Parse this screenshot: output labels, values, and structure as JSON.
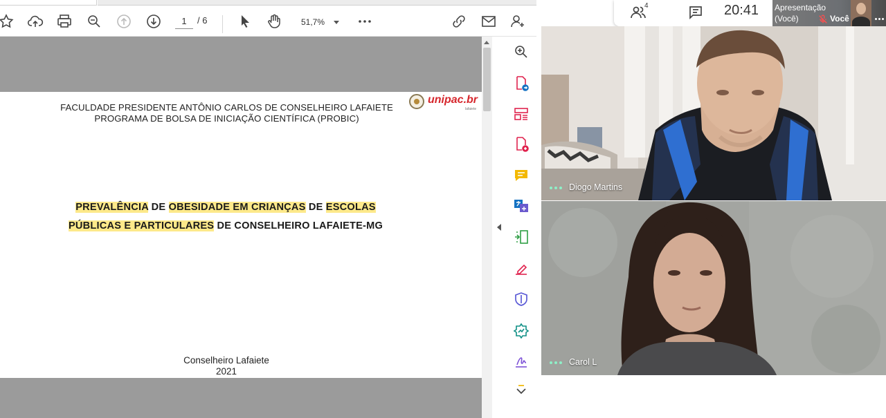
{
  "pdf_viewer": {
    "page": {
      "current": "1",
      "separator": "/ 6"
    },
    "zoom": "51,7%",
    "toolbar_icons": [
      "star-icon",
      "cloud-upload-icon",
      "print-icon",
      "zoom-out-icon",
      "page-up-icon",
      "page-down-icon",
      "select-cursor-icon",
      "hand-tool-icon",
      "more-icon",
      "link-icon",
      "mail-icon",
      "add-user-icon"
    ],
    "rail_icons": [
      "zoom-icon",
      "export-pdf-icon",
      "organize-pages-icon",
      "create-pdf-icon",
      "comment-icon",
      "translate-icon",
      "compress-icon",
      "fill-sign-icon",
      "protect-icon",
      "send-icon",
      "signature-icon",
      "more-tools-icon"
    ],
    "document": {
      "header_line1": "FACULDADE PRESIDENTE ANTÔNIO CARLOS DE CONSELHEIRO LAFAIETE",
      "header_line2": "PROGRAMA DE BOLSA DE INICIAÇÃO CIENTÍFICA (PROBIC)",
      "logo_text": "unipac.br",
      "logo_sub": "lafaiete",
      "title": {
        "l1_a": "PREVALÊNCIA",
        "l1_b": " DE ",
        "l1_c": "OBESIDADE EM CRIANÇAS",
        "l1_d": " DE ",
        "l1_e": "ESCOLAS",
        "l2_a": "PÚBLICAS E PARTICULARES",
        "l2_b": " DE CONSELHEIRO LAFAIETE-MG"
      },
      "city": "Conselheiro Lafaiete",
      "year": "2021"
    }
  },
  "meet": {
    "people_count": "4",
    "time": "20:41",
    "self_tile": {
      "line1": "Apresentação",
      "line2": "(Você)",
      "you_label": "Você"
    },
    "participants": [
      {
        "name": "Diogo Martins"
      },
      {
        "name": "Carol L"
      }
    ]
  }
}
